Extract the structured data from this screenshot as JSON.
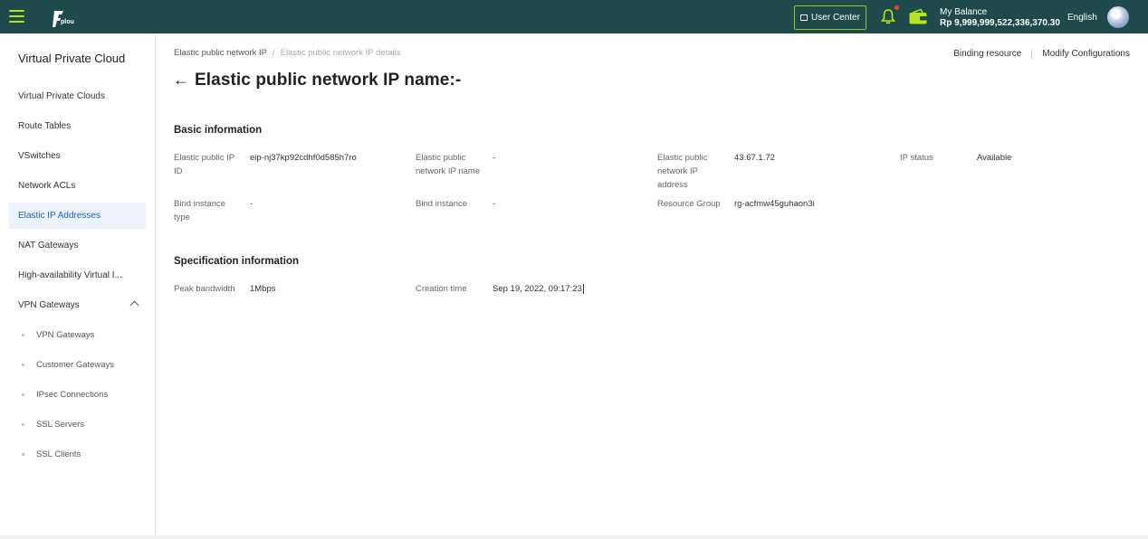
{
  "topbar": {
    "logo_text": "plou",
    "user_center_label": "User Center",
    "balance_label": "My Balance",
    "balance_value": "Rp 9,999,999,522,336,370.30",
    "language": "English",
    "accent_color": "#b5e61d",
    "bar_color": "#1e4a4b"
  },
  "sidebar": {
    "title": "Virtual Private Cloud",
    "items": [
      {
        "label": "Virtual Private Clouds"
      },
      {
        "label": "Route Tables"
      },
      {
        "label": "VSwitches"
      },
      {
        "label": "Network ACLs"
      },
      {
        "label": "Elastic IP Addresses",
        "active": true
      },
      {
        "label": "NAT Gateways"
      },
      {
        "label": "High-availability Virtual I..."
      },
      {
        "label": "VPN Gateways",
        "expanded": true
      }
    ],
    "sub_items": [
      {
        "label": "VPN Gateways"
      },
      {
        "label": "Customer Gateways"
      },
      {
        "label": "IPsec Connections"
      },
      {
        "label": "SSL Servers"
      },
      {
        "label": "SSL Clients"
      }
    ]
  },
  "breadcrumb": {
    "parent": "Elastic public network IP",
    "separator": "/",
    "current": "Elastic public network IP details"
  },
  "page": {
    "back_arrow": "←",
    "title": "Elastic public network IP name:-"
  },
  "actions": {
    "binding_resource": "Binding resource",
    "modify_configurations": "Modify Configurations"
  },
  "basic": {
    "title": "Basic information",
    "fields": [
      {
        "label": "Elastic public IP ID",
        "value": "eip-nj37kp92cdhf0d585h7ro"
      },
      {
        "label": "Elastic public network IP name",
        "value": "-"
      },
      {
        "label": "Elastic public network IP address",
        "value": "43.67.1.72"
      },
      {
        "label": "IP status",
        "value": "Available"
      },
      {
        "label": "Bind instance type",
        "value": "-"
      },
      {
        "label": "Bind instance",
        "value": "-"
      },
      {
        "label": "Resource Group",
        "value": "rg-acfmw45guhaon3i"
      }
    ]
  },
  "spec": {
    "title": "Specification information",
    "fields": [
      {
        "label": "Peak bandwidth",
        "value": "1Mbps"
      },
      {
        "label": "Creation time",
        "value": "Sep 19, 2022, 09:17:23"
      }
    ]
  }
}
